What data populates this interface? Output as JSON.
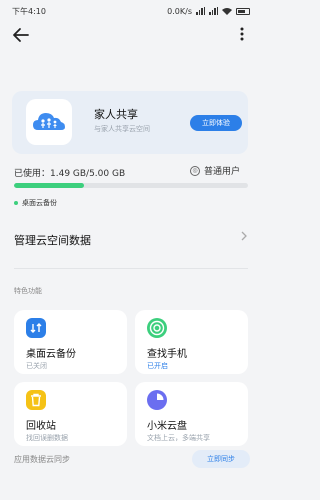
{
  "status_bar": {
    "time": "下午4:10",
    "network_speed": "0.0K/s"
  },
  "header": {
    "back_icon": "back-arrow-icon",
    "more_icon": "more-vert-icon"
  },
  "family_share": {
    "title": "家人共享",
    "subtitle": "与家人共享云空间",
    "try_button": "立即体验"
  },
  "storage": {
    "usage_text": "已使用：1.49 GB/5.00 GB",
    "used_gb": 1.49,
    "total_gb": 5.0,
    "user_level": "普通用户",
    "legend_label": "桌面云备份",
    "legend_color": "#3ccf7d"
  },
  "manage": {
    "label": "管理云空间数据"
  },
  "features": {
    "section_label": "特色功能",
    "items": [
      {
        "title": "桌面云备份",
        "status": "已关闭",
        "icon": "cloud-backup-icon",
        "color": "#2c7fe8"
      },
      {
        "title": "查找手机",
        "status": "已开启",
        "icon": "find-phone-icon",
        "color": "#3ccf7d"
      },
      {
        "title": "回收站",
        "status": "找回误删数据",
        "icon": "recycle-bin-icon",
        "color": "#f5c216"
      },
      {
        "title": "小米云盘",
        "status": "文档上云，多端共享",
        "icon": "cloud-drive-icon",
        "color": "#6b6ef0"
      }
    ]
  },
  "sync": {
    "label": "应用数据云同步",
    "button": "立即同步"
  }
}
